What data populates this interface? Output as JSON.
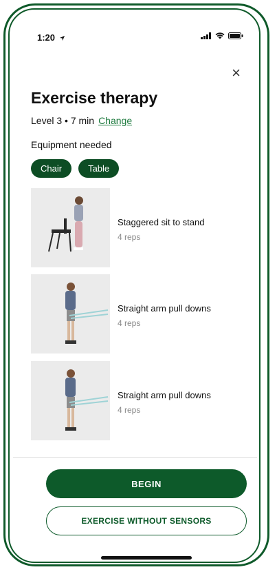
{
  "status_bar": {
    "time": "1:20",
    "location_icon": "location-arrow-icon",
    "signal_icon": "cellular-signal-icon",
    "wifi_icon": "wifi-icon",
    "battery_icon": "battery-icon"
  },
  "header": {
    "close_symbol": "×",
    "title": "Exercise therapy",
    "meta": "Level 3 • 7 min",
    "change_label": "Change"
  },
  "equipment": {
    "label": "Equipment needed",
    "items": [
      "Chair",
      "Table"
    ]
  },
  "exercises": [
    {
      "name": "Staggered sit to stand",
      "reps": "4 reps"
    },
    {
      "name": "Straight arm pull downs",
      "reps": "4 reps"
    },
    {
      "name": "Straight arm pull downs",
      "reps": "4 reps"
    }
  ],
  "actions": {
    "begin_label": "BEGIN",
    "no_sensors_label": "EXERCISE WITHOUT SENSORS"
  },
  "colors": {
    "brand_green": "#0d5a2a",
    "link_green": "#1d7a3e"
  }
}
